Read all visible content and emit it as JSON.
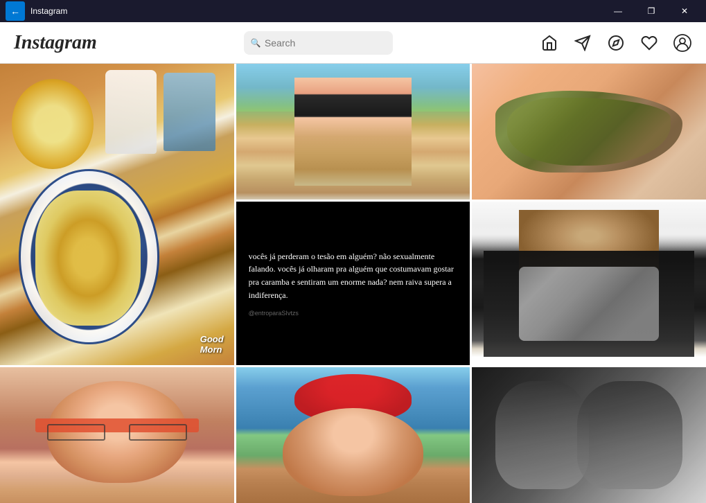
{
  "titlebar": {
    "title": "Instagram",
    "back_label": "←",
    "minimize_label": "—",
    "maximize_label": "❐",
    "close_label": "✕"
  },
  "header": {
    "logo": "Instagram",
    "search_placeholder": "Search"
  },
  "nav_icons": {
    "home": "⌂",
    "filter": "▽",
    "compass": "◎",
    "heart": "♡",
    "profile": "○"
  },
  "quote_post": {
    "text": "vocês já perderam o tesão em alguém? não sexualmente falando. vocês já olharam pra alguém que costumavam gostar pra caramba e sentiram um enorme nada? nem raiva supera a indiferença.",
    "caption": "@entroparaSIvtzs"
  },
  "grid_items": [
    {
      "id": "breakfast",
      "type": "image",
      "alt": "Breakfast with scrambled eggs and coffee"
    },
    {
      "id": "bikini",
      "type": "image",
      "alt": "Person in bikini outdoors"
    },
    {
      "id": "lizard",
      "type": "image",
      "alt": "Small lizard on hand"
    },
    {
      "id": "quote",
      "type": "text",
      "alt": "Quote post"
    },
    {
      "id": "footballer",
      "type": "image",
      "alt": "Footballer holding watch box"
    },
    {
      "id": "woman-glasses",
      "type": "image",
      "alt": "Woman with glasses"
    },
    {
      "id": "pink-cap",
      "type": "image",
      "alt": "Person with pink NY cap"
    },
    {
      "id": "couple",
      "type": "image",
      "alt": "Couple in black and white"
    }
  ]
}
